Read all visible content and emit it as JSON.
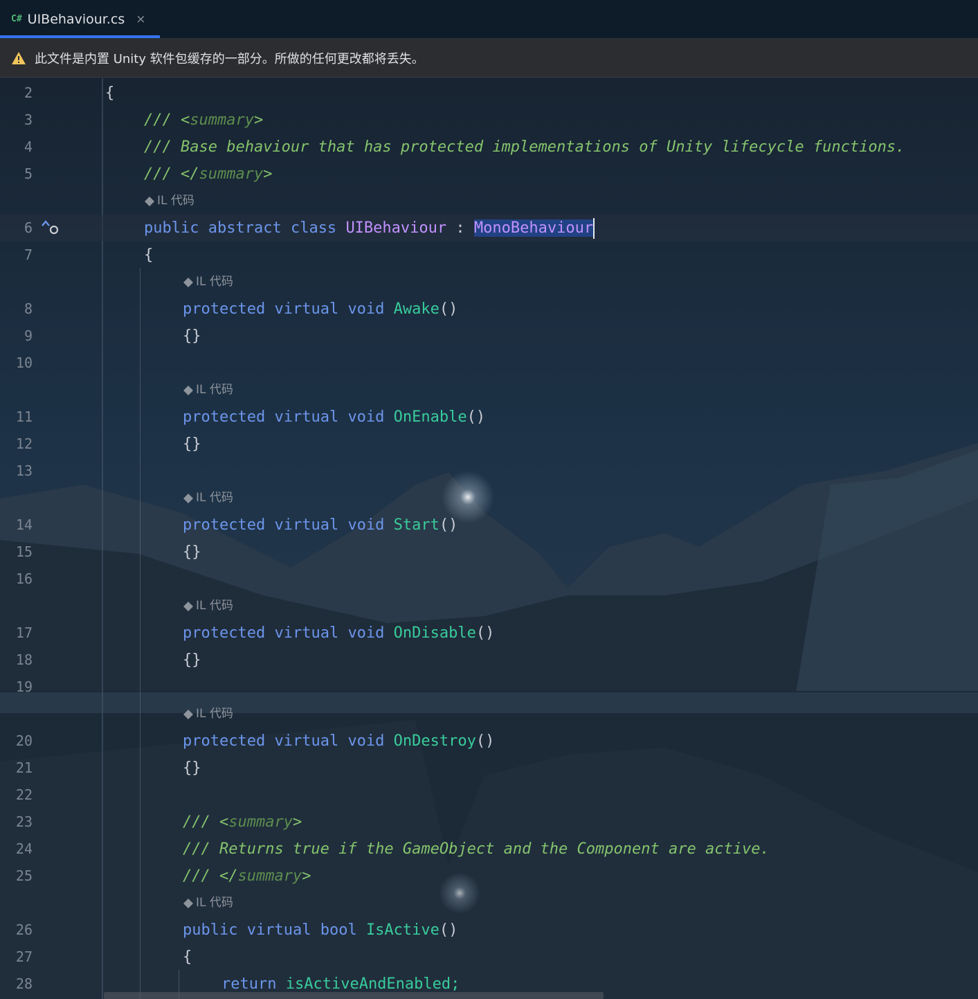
{
  "tab": {
    "language_badge": "C#",
    "filename": "UIBehaviour.cs",
    "close_glyph": "×"
  },
  "banner": {
    "icon": "warning-triangle-icon",
    "text": "此文件是内置 Unity 软件包缓存的一部分。所做的任何更改都将丢失。"
  },
  "hint_label": "IL 代码",
  "colors": {
    "keyword": "#6c95eb",
    "class": "#c191ff",
    "method": "#39cc9b",
    "doc_comment": "#85c46c",
    "tab_accent": "#3574f0"
  },
  "code": {
    "l2": "{",
    "l3": {
      "slashes": "/// ",
      "open": "<",
      "name": "summary",
      "close": ">"
    },
    "l4": "/// Base behaviour that has protected implementations of Unity lifecycle functions.",
    "l5": {
      "slashes": "/// ",
      "open": "</",
      "name": "summary",
      "close": ">"
    },
    "l6": {
      "kw1": "public",
      "kw2": "abstract",
      "kw3": "class",
      "name": "UIBehaviour",
      "colon": ":",
      "base": "MonoBehaviour"
    },
    "l7": "{",
    "m8": {
      "kw1": "protected",
      "kw2": "virtual",
      "kw3": "void",
      "name": "Awake",
      "parens": "()"
    },
    "b9": "{}",
    "m11": {
      "kw1": "protected",
      "kw2": "virtual",
      "kw3": "void",
      "name": "OnEnable",
      "parens": "()"
    },
    "b12": "{}",
    "m14": {
      "kw1": "protected",
      "kw2": "virtual",
      "kw3": "void",
      "name": "Start",
      "parens": "()"
    },
    "b15": "{}",
    "m17": {
      "kw1": "protected",
      "kw2": "virtual",
      "kw3": "void",
      "name": "OnDisable",
      "parens": "()"
    },
    "b18": "{}",
    "m20": {
      "kw1": "protected",
      "kw2": "virtual",
      "kw3": "void",
      "name": "OnDestroy",
      "parens": "()"
    },
    "b21": "{}",
    "l23": {
      "slashes": "/// ",
      "open": "<",
      "name": "summary",
      "close": ">"
    },
    "l24": "/// Returns true if the GameObject and the Component are active.",
    "l25": {
      "slashes": "/// ",
      "open": "</",
      "name": "summary",
      "close": ">"
    },
    "l26": {
      "kw1": "public",
      "kw2": "virtual",
      "kw3": "bool",
      "name": "IsActive",
      "parens": "()"
    },
    "l27": "{",
    "l28": {
      "kw": "return",
      "expr": "isActiveAndEnabled;"
    }
  },
  "line_numbers": {
    "n2": "2",
    "n3": "3",
    "n4": "4",
    "n5": "5",
    "n6": "6",
    "n7": "7",
    "n8": "8",
    "n9": "9",
    "n10": "10",
    "n11": "11",
    "n12": "12",
    "n13": "13",
    "n14": "14",
    "n15": "15",
    "n16": "16",
    "n17": "17",
    "n18": "18",
    "n19": "19",
    "n20": "20",
    "n21": "21",
    "n22": "22",
    "n23": "23",
    "n24": "24",
    "n25": "25",
    "n26": "26",
    "n27": "27",
    "n28": "28"
  }
}
